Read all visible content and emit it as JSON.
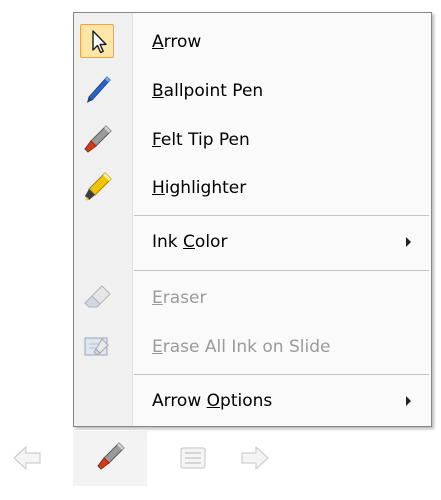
{
  "menu": {
    "items": [
      {
        "label": "Arrow",
        "mnemonic": "A",
        "rest": "rrow",
        "enabled": true,
        "checked": true,
        "icon": "arrow-cursor-icon"
      },
      {
        "label": "Ballpoint Pen",
        "mnemonic": "B",
        "rest": "allpoint Pen",
        "enabled": true,
        "checked": false,
        "icon": "ballpoint-pen-icon"
      },
      {
        "label": "Felt Tip Pen",
        "mnemonic": "F",
        "rest": "elt Tip Pen",
        "enabled": true,
        "checked": false,
        "icon": "felt-tip-pen-icon"
      },
      {
        "label": "Highlighter",
        "mnemonic": "H",
        "rest": "ighlighter",
        "enabled": true,
        "checked": false,
        "icon": "highlighter-icon"
      },
      {
        "label": "Ink Color",
        "before": "Ink ",
        "mnemonic": "C",
        "rest": "olor",
        "enabled": true,
        "submenu": true
      },
      {
        "label": "Eraser",
        "mnemonic": "E",
        "rest": "raser",
        "enabled": false,
        "icon": "eraser-icon"
      },
      {
        "label": "Erase All Ink on Slide",
        "mnemonic": "E",
        "rest": "rase All Ink on Slide",
        "enabled": false,
        "icon": "erase-all-ink-icon"
      },
      {
        "label": "Arrow Options",
        "before": "Arrow ",
        "mnemonic": "O",
        "rest": "ptions",
        "enabled": true,
        "submenu": true
      }
    ]
  },
  "toolbar": {
    "buttons": [
      "previous-slide",
      "pen",
      "slide-menu",
      "next-slide"
    ]
  },
  "colors": {
    "checked_bg": "#fde6a8",
    "checked_border": "#f2a33a",
    "ballpoint_pen": "#2a64c8",
    "felt_tip_pen": "#d23a1c",
    "highlighter": "#f0c400"
  }
}
